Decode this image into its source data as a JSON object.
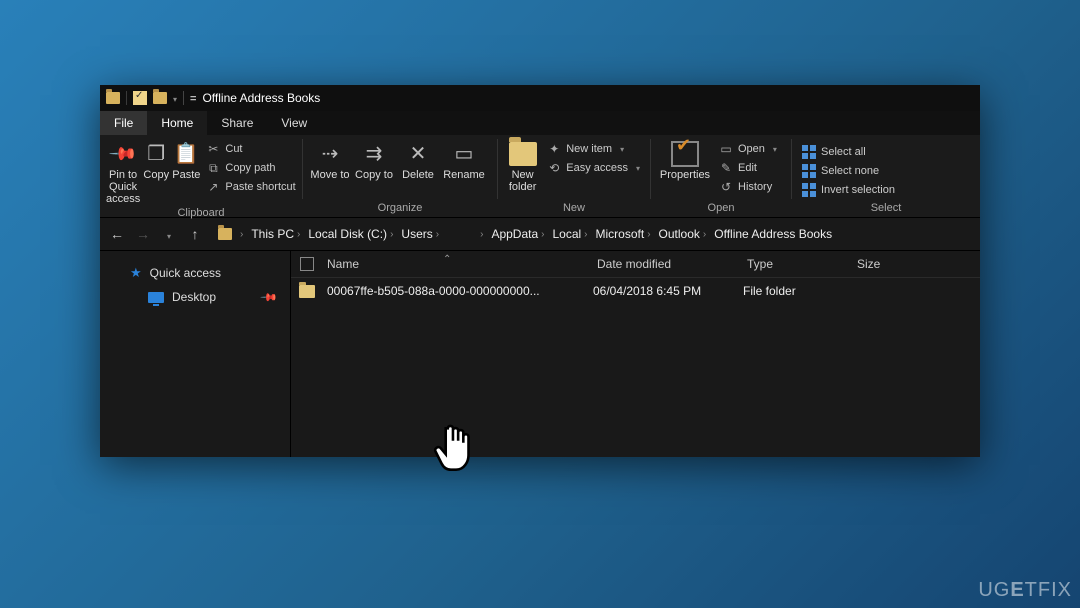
{
  "title": "Offline Address Books",
  "tabs": {
    "file": "File",
    "home": "Home",
    "share": "Share",
    "view": "View"
  },
  "ribbon": {
    "pin_to_quick": "Pin to Quick access",
    "copy": "Copy",
    "paste": "Paste",
    "cut": "Cut",
    "copy_path": "Copy path",
    "paste_shortcut": "Paste shortcut",
    "group_clipboard": "Clipboard",
    "move_to": "Move to",
    "copy_to": "Copy to",
    "delete": "Delete",
    "rename": "Rename",
    "group_organize": "Organize",
    "new_folder": "New folder",
    "new_item": "New item",
    "easy_access": "Easy access",
    "group_new": "New",
    "properties": "Properties",
    "open": "Open",
    "edit": "Edit",
    "history": "History",
    "group_open": "Open",
    "select_all": "Select all",
    "select_none": "Select none",
    "invert": "Invert selection",
    "group_select": "Select"
  },
  "breadcrumb": [
    "This PC",
    "Local Disk (C:)",
    "Users",
    "",
    "AppData",
    "Local",
    "Microsoft",
    "Outlook",
    "Offline Address Books"
  ],
  "sidebar": {
    "quick": "Quick access",
    "desktop": "Desktop"
  },
  "columns": {
    "name": "Name",
    "date": "Date modified",
    "type": "Type",
    "size": "Size"
  },
  "rows": [
    {
      "name": "00067ffe-b505-088a-0000-000000000...",
      "date": "06/04/2018 6:45 PM",
      "type": "File folder",
      "size": ""
    }
  ],
  "watermark": "UGETFIX"
}
